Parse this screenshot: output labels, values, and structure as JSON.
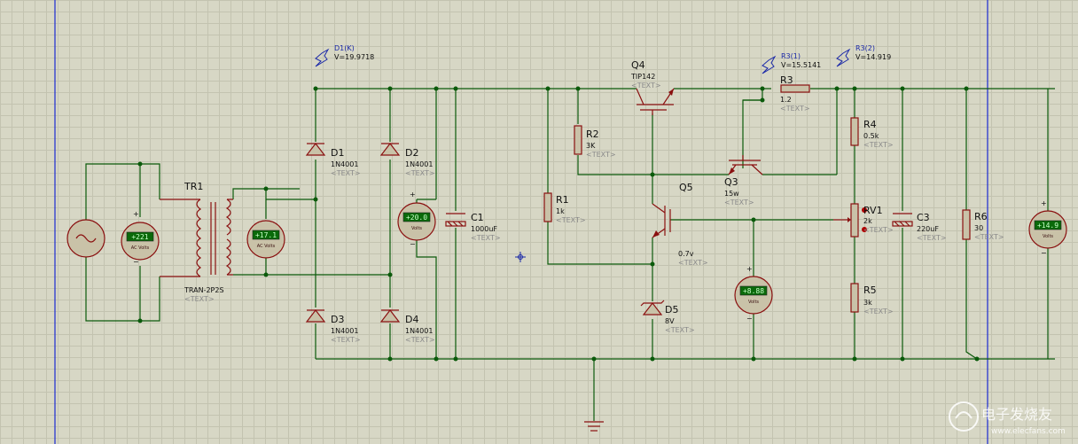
{
  "sheet": {
    "border_color": "#1a2ad0",
    "wire_color": "#0b5a0b",
    "part_color": "#8a1010"
  },
  "probes": {
    "d1k": {
      "name": "D1(K)",
      "voltage": "V=19.9718"
    },
    "r3_1": {
      "name": "R3(1)",
      "voltage": "V=15.5141"
    },
    "r3_2": {
      "name": "R3(2)",
      "voltage": "V=14.919"
    }
  },
  "components": {
    "tr1": {
      "ref": "TR1",
      "value": "TRAN-2P2S",
      "text": "<TEXT>"
    },
    "d1": {
      "ref": "D1",
      "value": "1N4001",
      "text": "<TEXT>"
    },
    "d2": {
      "ref": "D2",
      "value": "1N4001",
      "text": "<TEXT>"
    },
    "d3": {
      "ref": "D3",
      "value": "1N4001",
      "text": "<TEXT>"
    },
    "d4": {
      "ref": "D4",
      "value": "1N4001",
      "text": "<TEXT>"
    },
    "c1": {
      "ref": "C1",
      "value": "1000uF",
      "text": "<TEXT>"
    },
    "r1": {
      "ref": "R1",
      "value": "1k",
      "text": "<TEXT>"
    },
    "r2": {
      "ref": "R2",
      "value": "3K",
      "text": "<TEXT>"
    },
    "q4": {
      "ref": "Q4",
      "value": "TIP142",
      "text": "<TEXT>"
    },
    "q5": {
      "ref": "Q5",
      "value": "0.7v",
      "text": "<TEXT>"
    },
    "d5": {
      "ref": "D5",
      "value": "8V",
      "text": "<TEXT>"
    },
    "q3": {
      "ref": "Q3",
      "value": "15w",
      "text": "<TEXT>"
    },
    "r3": {
      "ref": "R3",
      "value": "1.2",
      "text": "<TEXT>"
    },
    "r4": {
      "ref": "R4",
      "value": "0.5k",
      "text": "<TEXT>"
    },
    "rv1": {
      "ref": "RV1",
      "value": "2k",
      "text": "<TEXT>"
    },
    "r5": {
      "ref": "R5",
      "value": "3k",
      "text": "<TEXT>"
    },
    "c3": {
      "ref": "C3",
      "value": "220uF",
      "text": "<TEXT>"
    },
    "r6": {
      "ref": "R6",
      "value": "30",
      "text": "<TEXT>"
    }
  },
  "meters": {
    "m1": {
      "reading": "+221",
      "unit": "AC Volts"
    },
    "m2": {
      "reading": "+17.1",
      "unit": "AC Volts"
    },
    "m3": {
      "reading": "+20.0",
      "unit": "Volts"
    },
    "m4": {
      "reading": "+8.88",
      "unit": "Volts"
    },
    "m5": {
      "reading": "+14.9",
      "unit": "Volts"
    }
  },
  "meter_signs": {
    "plus": "+",
    "minus": "−"
  },
  "watermark": {
    "brand": "电子发烧友",
    "site": "www.elecfans.com"
  }
}
